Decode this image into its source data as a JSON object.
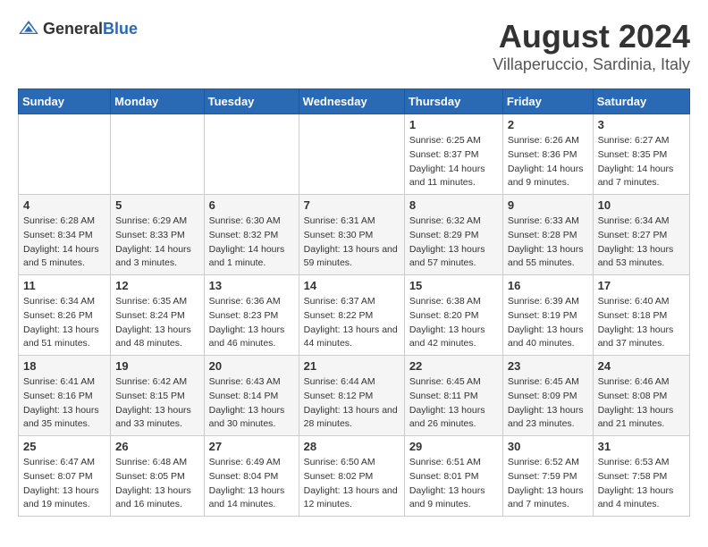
{
  "logo": {
    "text_general": "General",
    "text_blue": "Blue"
  },
  "title": "August 2024",
  "subtitle": "Villaperuccio, Sardinia, Italy",
  "days_of_week": [
    "Sunday",
    "Monday",
    "Tuesday",
    "Wednesday",
    "Thursday",
    "Friday",
    "Saturday"
  ],
  "weeks": [
    [
      {
        "day": "",
        "sunrise": "",
        "sunset": "",
        "daylight": ""
      },
      {
        "day": "",
        "sunrise": "",
        "sunset": "",
        "daylight": ""
      },
      {
        "day": "",
        "sunrise": "",
        "sunset": "",
        "daylight": ""
      },
      {
        "day": "",
        "sunrise": "",
        "sunset": "",
        "daylight": ""
      },
      {
        "day": "1",
        "sunrise": "Sunrise: 6:25 AM",
        "sunset": "Sunset: 8:37 PM",
        "daylight": "Daylight: 14 hours and 11 minutes."
      },
      {
        "day": "2",
        "sunrise": "Sunrise: 6:26 AM",
        "sunset": "Sunset: 8:36 PM",
        "daylight": "Daylight: 14 hours and 9 minutes."
      },
      {
        "day": "3",
        "sunrise": "Sunrise: 6:27 AM",
        "sunset": "Sunset: 8:35 PM",
        "daylight": "Daylight: 14 hours and 7 minutes."
      }
    ],
    [
      {
        "day": "4",
        "sunrise": "Sunrise: 6:28 AM",
        "sunset": "Sunset: 8:34 PM",
        "daylight": "Daylight: 14 hours and 5 minutes."
      },
      {
        "day": "5",
        "sunrise": "Sunrise: 6:29 AM",
        "sunset": "Sunset: 8:33 PM",
        "daylight": "Daylight: 14 hours and 3 minutes."
      },
      {
        "day": "6",
        "sunrise": "Sunrise: 6:30 AM",
        "sunset": "Sunset: 8:32 PM",
        "daylight": "Daylight: 14 hours and 1 minute."
      },
      {
        "day": "7",
        "sunrise": "Sunrise: 6:31 AM",
        "sunset": "Sunset: 8:30 PM",
        "daylight": "Daylight: 13 hours and 59 minutes."
      },
      {
        "day": "8",
        "sunrise": "Sunrise: 6:32 AM",
        "sunset": "Sunset: 8:29 PM",
        "daylight": "Daylight: 13 hours and 57 minutes."
      },
      {
        "day": "9",
        "sunrise": "Sunrise: 6:33 AM",
        "sunset": "Sunset: 8:28 PM",
        "daylight": "Daylight: 13 hours and 55 minutes."
      },
      {
        "day": "10",
        "sunrise": "Sunrise: 6:34 AM",
        "sunset": "Sunset: 8:27 PM",
        "daylight": "Daylight: 13 hours and 53 minutes."
      }
    ],
    [
      {
        "day": "11",
        "sunrise": "Sunrise: 6:34 AM",
        "sunset": "Sunset: 8:26 PM",
        "daylight": "Daylight: 13 hours and 51 minutes."
      },
      {
        "day": "12",
        "sunrise": "Sunrise: 6:35 AM",
        "sunset": "Sunset: 8:24 PM",
        "daylight": "Daylight: 13 hours and 48 minutes."
      },
      {
        "day": "13",
        "sunrise": "Sunrise: 6:36 AM",
        "sunset": "Sunset: 8:23 PM",
        "daylight": "Daylight: 13 hours and 46 minutes."
      },
      {
        "day": "14",
        "sunrise": "Sunrise: 6:37 AM",
        "sunset": "Sunset: 8:22 PM",
        "daylight": "Daylight: 13 hours and 44 minutes."
      },
      {
        "day": "15",
        "sunrise": "Sunrise: 6:38 AM",
        "sunset": "Sunset: 8:20 PM",
        "daylight": "Daylight: 13 hours and 42 minutes."
      },
      {
        "day": "16",
        "sunrise": "Sunrise: 6:39 AM",
        "sunset": "Sunset: 8:19 PM",
        "daylight": "Daylight: 13 hours and 40 minutes."
      },
      {
        "day": "17",
        "sunrise": "Sunrise: 6:40 AM",
        "sunset": "Sunset: 8:18 PM",
        "daylight": "Daylight: 13 hours and 37 minutes."
      }
    ],
    [
      {
        "day": "18",
        "sunrise": "Sunrise: 6:41 AM",
        "sunset": "Sunset: 8:16 PM",
        "daylight": "Daylight: 13 hours and 35 minutes."
      },
      {
        "day": "19",
        "sunrise": "Sunrise: 6:42 AM",
        "sunset": "Sunset: 8:15 PM",
        "daylight": "Daylight: 13 hours and 33 minutes."
      },
      {
        "day": "20",
        "sunrise": "Sunrise: 6:43 AM",
        "sunset": "Sunset: 8:14 PM",
        "daylight": "Daylight: 13 hours and 30 minutes."
      },
      {
        "day": "21",
        "sunrise": "Sunrise: 6:44 AM",
        "sunset": "Sunset: 8:12 PM",
        "daylight": "Daylight: 13 hours and 28 minutes."
      },
      {
        "day": "22",
        "sunrise": "Sunrise: 6:45 AM",
        "sunset": "Sunset: 8:11 PM",
        "daylight": "Daylight: 13 hours and 26 minutes."
      },
      {
        "day": "23",
        "sunrise": "Sunrise: 6:45 AM",
        "sunset": "Sunset: 8:09 PM",
        "daylight": "Daylight: 13 hours and 23 minutes."
      },
      {
        "day": "24",
        "sunrise": "Sunrise: 6:46 AM",
        "sunset": "Sunset: 8:08 PM",
        "daylight": "Daylight: 13 hours and 21 minutes."
      }
    ],
    [
      {
        "day": "25",
        "sunrise": "Sunrise: 6:47 AM",
        "sunset": "Sunset: 8:07 PM",
        "daylight": "Daylight: 13 hours and 19 minutes."
      },
      {
        "day": "26",
        "sunrise": "Sunrise: 6:48 AM",
        "sunset": "Sunset: 8:05 PM",
        "daylight": "Daylight: 13 hours and 16 minutes."
      },
      {
        "day": "27",
        "sunrise": "Sunrise: 6:49 AM",
        "sunset": "Sunset: 8:04 PM",
        "daylight": "Daylight: 13 hours and 14 minutes."
      },
      {
        "day": "28",
        "sunrise": "Sunrise: 6:50 AM",
        "sunset": "Sunset: 8:02 PM",
        "daylight": "Daylight: 13 hours and 12 minutes."
      },
      {
        "day": "29",
        "sunrise": "Sunrise: 6:51 AM",
        "sunset": "Sunset: 8:01 PM",
        "daylight": "Daylight: 13 hours and 9 minutes."
      },
      {
        "day": "30",
        "sunrise": "Sunrise: 6:52 AM",
        "sunset": "Sunset: 7:59 PM",
        "daylight": "Daylight: 13 hours and 7 minutes."
      },
      {
        "day": "31",
        "sunrise": "Sunrise: 6:53 AM",
        "sunset": "Sunset: 7:58 PM",
        "daylight": "Daylight: 13 hours and 4 minutes."
      }
    ]
  ]
}
